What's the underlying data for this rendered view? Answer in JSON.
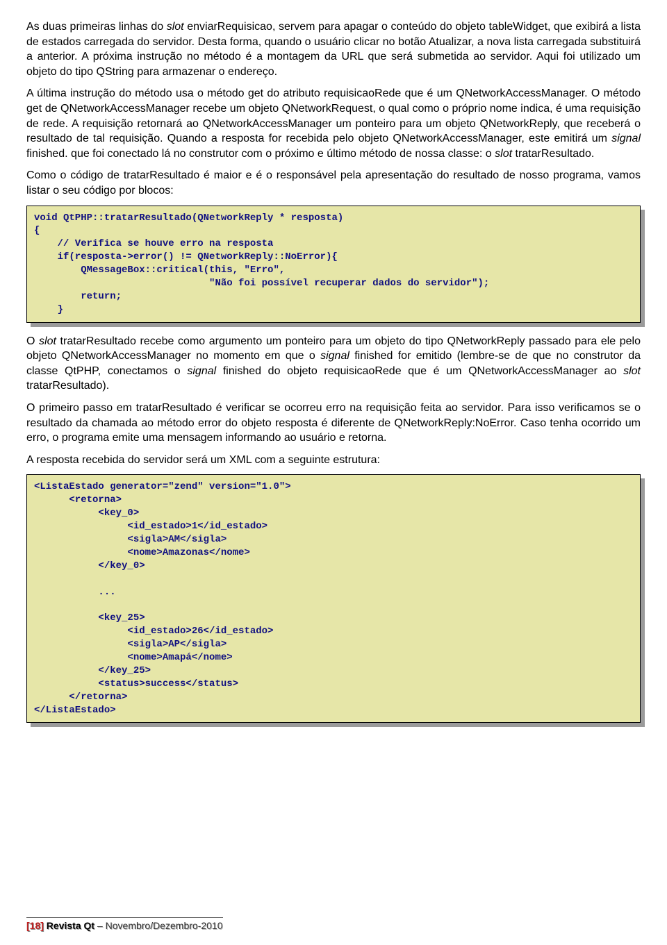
{
  "paragraphs": {
    "p1_a": "As duas primeiras linhas do ",
    "p1_slot": "slot",
    "p1_b": " enviarRequisicao, servem para apagar o conteúdo do objeto tableWidget, que exibirá a lista de estados carregada do servidor. Desta forma, quando o usuário clicar no botão Atualizar, a nova lista carregada substituirá a anterior. A próxima instrução no método é a montagem da URL que será submetida ao servidor. Aqui foi utilizado um objeto do tipo QString para armazenar o endereço.",
    "p2_a": "A última instrução do método usa o método get do atributo requisicaoRede que é um QNetworkAccessManager. O método get de QNetworkAccessManager recebe um objeto QNetworkRequest, o qual como o próprio nome indica, é uma requisição de rede. A requisição retornará ao QNetworkAccessManager um ponteiro para um objeto QNetworkReply, que receberá o resultado de tal requisição. Quando a resposta for recebida pelo objeto QNetworkAccessManager, este emitirá um ",
    "p2_sig": "signal",
    "p2_b": " finished. que foi conectado lá no construtor com o próximo e último método de nossa classe: o ",
    "p2_slot": "slot",
    "p2_c": " tratarResultado.",
    "p3": "Como o código de tratarResultado é maior e é o responsável pela apresentação do resultado de nosso programa, vamos listar o seu código por blocos:",
    "p4_a": "O ",
    "p4_slot": "slot",
    "p4_b": " tratarResultado recebe como argumento um ponteiro para um objeto do tipo QNetworkReply passado para ele pelo objeto QNetworkAccessManager no momento em que o ",
    "p4_sig1": "signal",
    "p4_c": " finished for emitido (lembre-se de que no construtor da classe QtPHP, conectamos o ",
    "p4_sig2": "signal",
    "p4_d": " finished do objeto requisicaoRede que é um QNetworkAccessManager ao ",
    "p4_slot2": "slot",
    "p4_e": " tratarResultado).",
    "p5": "O primeiro passo em tratarResultado é verificar se ocorreu erro na requisição feita ao servidor. Para isso verificamos se o resultado da chamada ao método error do objeto resposta é diferente de QNetworkReply:NoError. Caso tenha ocorrido um erro, o programa emite uma mensagem informando ao usuário e retorna.",
    "p6": "A resposta recebida do servidor será um XML com a seguinte estrutura:"
  },
  "code1": "void QtPHP::tratarResultado(QNetworkReply * resposta)\n{\n    // Verifica se houve erro na resposta\n    if(resposta->error() != QNetworkReply::NoError){\n        QMessageBox::critical(this, \"Erro\",\n                              \"Não foi possível recuperar dados do servidor\");\n        return;\n    }",
  "code2": "<ListaEstado generator=\"zend\" version=\"1.0\">\n      <retorna>\n           <key_0>\n                <id_estado>1</id_estado>\n                <sigla>AM</sigla>\n                <nome>Amazonas</nome>\n           </key_0>\n\n           ...\n\n           <key_25>\n                <id_estado>26</id_estado>\n                <sigla>AP</sigla>\n                <nome>Amapá</nome>\n           </key_25>\n           <status>success</status>\n      </retorna>\n</ListaEstado>",
  "footer": {
    "page_open": "[",
    "page_num": "18",
    "page_close": "]",
    "magazine": " Revista Qt",
    "sep": " – ",
    "date": "Novembro/Dezembro-2010"
  }
}
